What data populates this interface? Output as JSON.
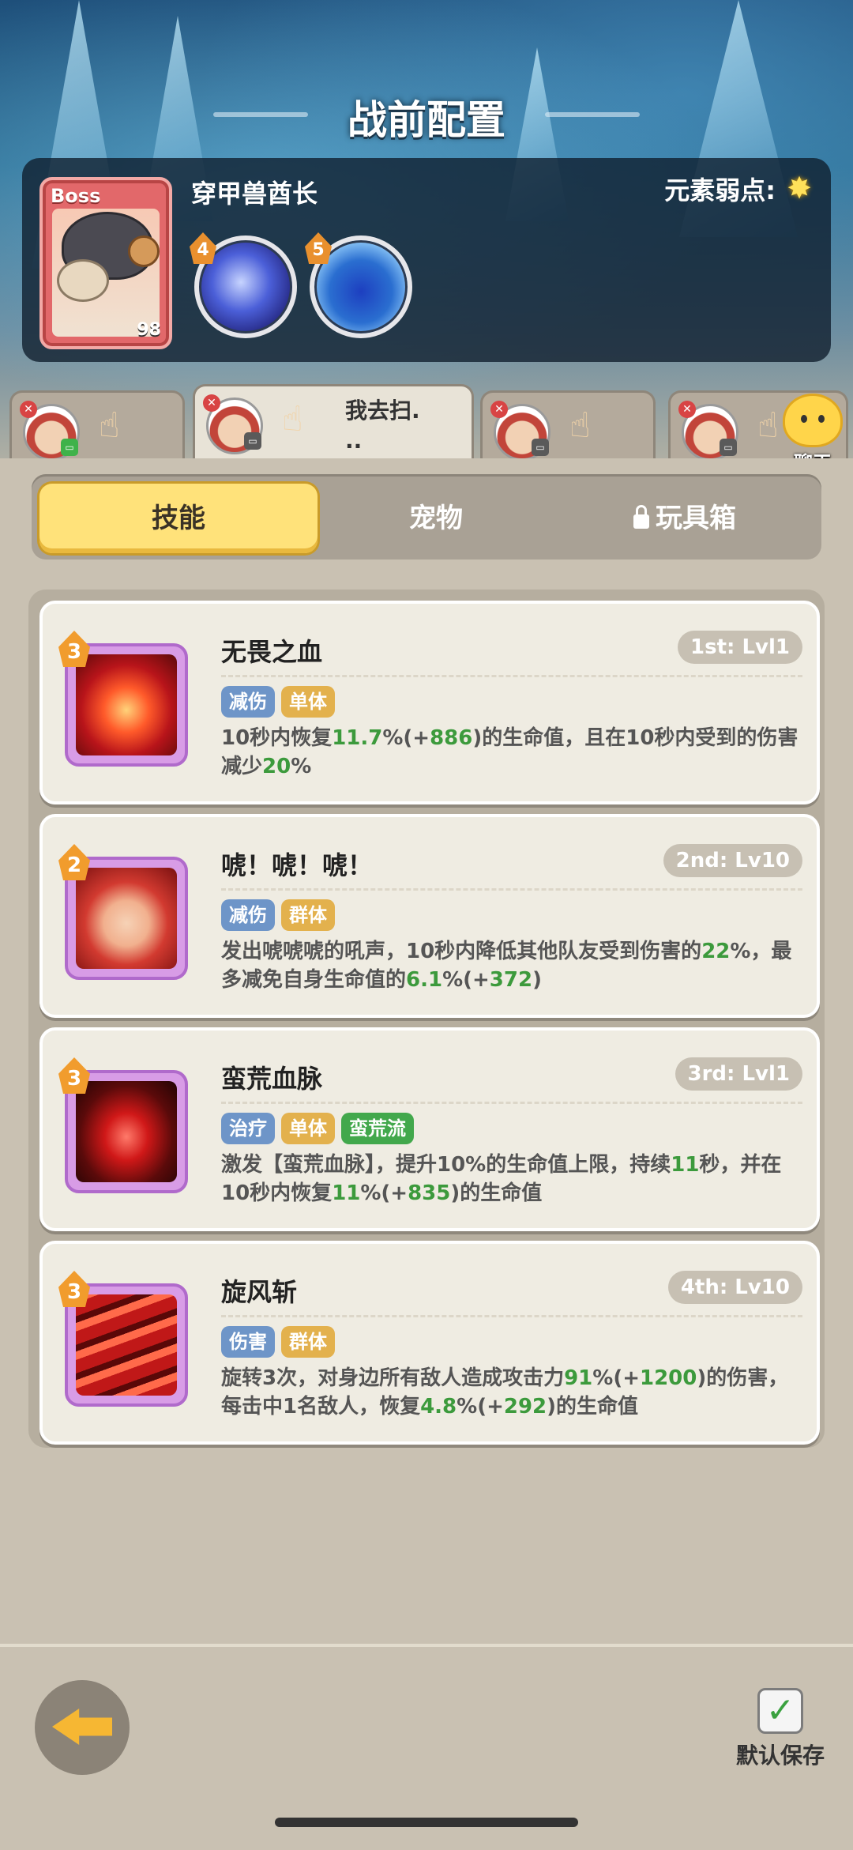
{
  "screen_title": "战前配置",
  "boss": {
    "badge": "Boss",
    "level": "98",
    "name": "穿甲兽酋长",
    "weakness_label": "元素弱点:",
    "weakness_icon": "star-burst-icon",
    "orbs": [
      {
        "level": "4",
        "icon": "blue-vortex-orb-icon"
      },
      {
        "level": "5",
        "icon": "blue-splash-orb-icon"
      }
    ]
  },
  "team_tabs": [
    {
      "status": "green",
      "text": ""
    },
    {
      "status": "gray",
      "text": "我去扫.\n.."
    },
    {
      "status": "gray",
      "text": ""
    },
    {
      "status": "gray",
      "text": ""
    }
  ],
  "chat": {
    "label": "聊天"
  },
  "segments": {
    "skills": "技能",
    "pets": "宠物",
    "toybox": "玩具箱"
  },
  "skills": [
    {
      "level": "3",
      "name": "无畏之血",
      "rank": "1st: Lvl1",
      "tags": [
        {
          "text": "减伤",
          "color": "blue"
        },
        {
          "text": "单体",
          "color": "orange"
        }
      ],
      "desc": [
        {
          "t": "10秒内恢复"
        },
        {
          "t": "11.7",
          "h": true
        },
        {
          "t": "%(+"
        },
        {
          "t": "886",
          "h": true
        },
        {
          "t": ")的生命值，且在10秒内受到的伤害减少"
        },
        {
          "t": "20",
          "h": true
        },
        {
          "t": "%"
        }
      ]
    },
    {
      "level": "2",
      "name": "唬！唬！唬！",
      "rank": "2nd: Lv10",
      "tags": [
        {
          "text": "减伤",
          "color": "blue"
        },
        {
          "text": "群体",
          "color": "orange"
        }
      ],
      "desc": [
        {
          "t": "发出唬唬唬的吼声，10秒内降低其他队友受到伤害的"
        },
        {
          "t": "22",
          "h": true
        },
        {
          "t": "%，最多减免自身生命值的"
        },
        {
          "t": "6.1",
          "h": true
        },
        {
          "t": "%(+"
        },
        {
          "t": "372",
          "h": true
        },
        {
          "t": ")"
        }
      ]
    },
    {
      "level": "3",
      "name": "蛮荒血脉",
      "rank": "3rd: Lvl1",
      "tags": [
        {
          "text": "治疗",
          "color": "blue"
        },
        {
          "text": "单体",
          "color": "orange"
        },
        {
          "text": "蛮荒流",
          "color": "green"
        }
      ],
      "desc": [
        {
          "t": "激发【蛮荒血脉】，提升10%的生命值上限，持续"
        },
        {
          "t": "11",
          "h": true
        },
        {
          "t": "秒，并在10秒内恢复"
        },
        {
          "t": "11",
          "h": true
        },
        {
          "t": "%(+"
        },
        {
          "t": "835",
          "h": true
        },
        {
          "t": ")的生命值"
        }
      ]
    },
    {
      "level": "3",
      "name": "旋风斩",
      "rank": "4th: Lv10",
      "tags": [
        {
          "text": "伤害",
          "color": "blue"
        },
        {
          "text": "群体",
          "color": "orange"
        }
      ],
      "desc": [
        {
          "t": "旋转3次，对身边所有敌人造成攻击力"
        },
        {
          "t": "91",
          "h": true
        },
        {
          "t": "%(+"
        },
        {
          "t": "1200",
          "h": true
        },
        {
          "t": ")的伤害，每击中1名敌人，恢复"
        },
        {
          "t": "4.8",
          "h": true
        },
        {
          "t": "%(+"
        },
        {
          "t": "292",
          "h": true
        },
        {
          "t": ")的生命值"
        }
      ]
    }
  ],
  "bottom": {
    "save_label": "默认保存",
    "save_checked": true
  }
}
